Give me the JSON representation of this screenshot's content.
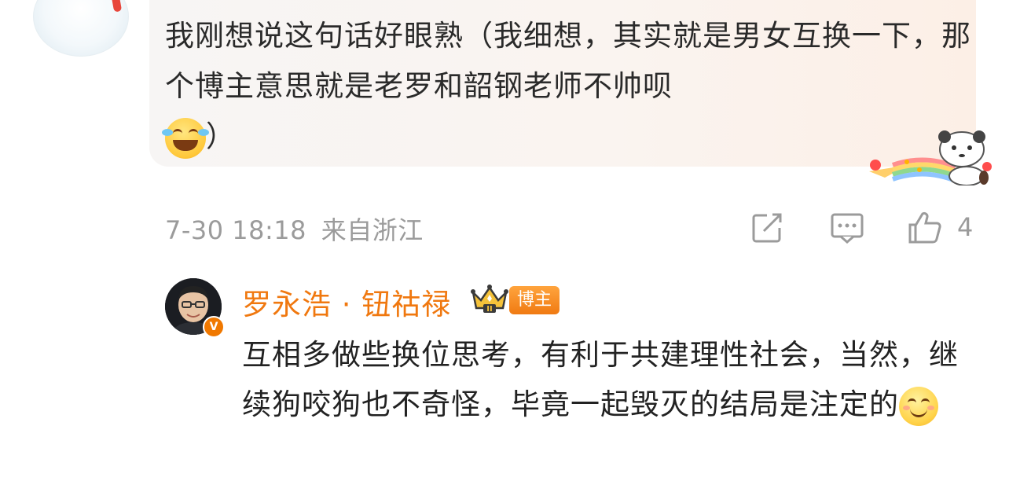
{
  "comment": {
    "text": "我刚想说这句话好眼熟（我细想，其实就是男女互换一下，那个博主意思就是老罗和韶钢老师不帅呗",
    "text_tail": "）",
    "emoji": "laugh-cry-icon",
    "date": "7-30 18:18",
    "location": "来自浙江",
    "like_count": "4"
  },
  "reply": {
    "author": "罗永浩 · 钮祜禄",
    "tag": "博主",
    "crown_level": "II",
    "verified_mark": "V",
    "text": "互相多做些换位思考，有利于共建理性社会，当然，继续狗咬狗也不奇怪，毕竟一起毁灭的结局是注定的",
    "emoji": "smile-icon"
  },
  "colors": {
    "name": "#f0780f",
    "meta": "#9b9b9b",
    "bubble": "#faf4f0",
    "tag": "#f07a12"
  }
}
